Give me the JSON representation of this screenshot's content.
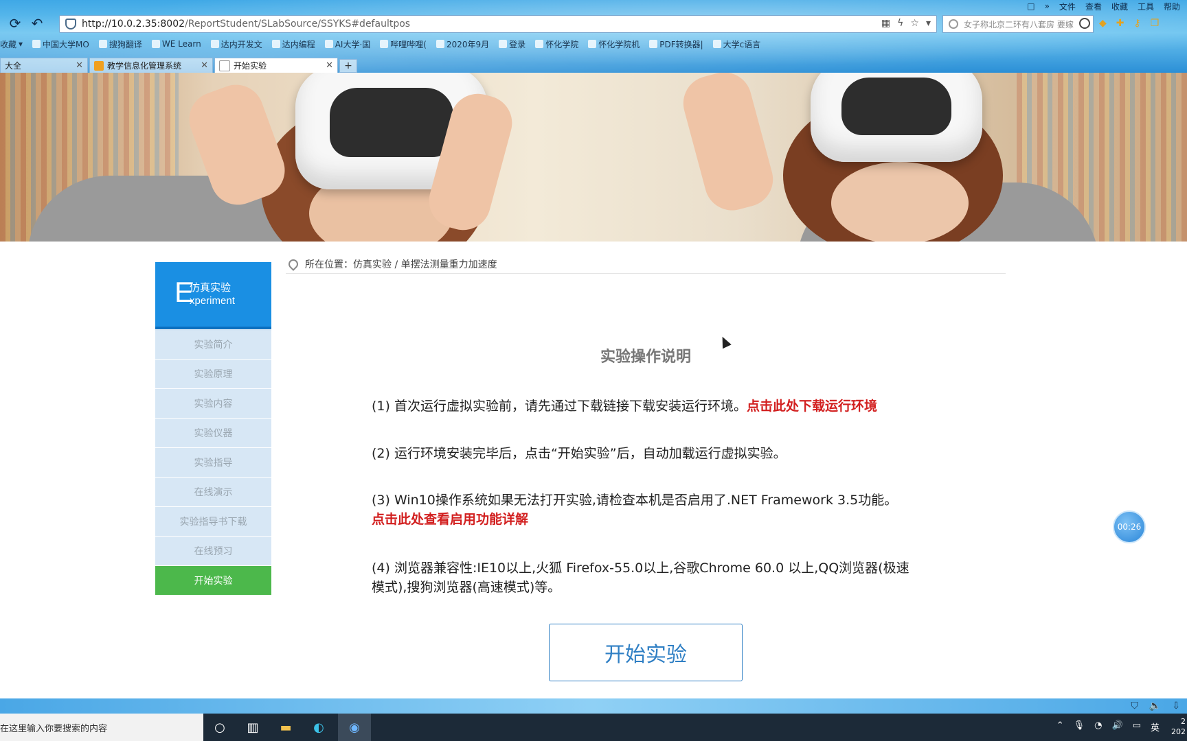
{
  "browser": {
    "menu": [
      "文件",
      "查看",
      "收藏",
      "工具",
      "帮助"
    ],
    "url_host": "http://10.0.2.35:8002",
    "url_path": "/ReportStudent/SLabSource/SSYKS#defaultpos",
    "search_text": "女子称北京二环有八套房 要嫁",
    "bookmarks": [
      "收藏",
      "中国大学MO",
      "搜狗翻译",
      "WE Learn",
      "达内开发文",
      "达内编程",
      "AI大学·国",
      "哔哩哔哩(",
      "2020年9月",
      "登录",
      "怀化学院",
      "怀化学院机",
      "PDF转换器|",
      "大学c语言"
    ],
    "tabs": [
      {
        "label": "大全",
        "active": false
      },
      {
        "label": "教学信息化管理系统",
        "active": false
      },
      {
        "label": "开始实验",
        "active": true
      }
    ],
    "new_tab": "+"
  },
  "sidebar": {
    "logo_letter": "E",
    "logo_cn": "仿真实验",
    "logo_en": "xperiment",
    "items": [
      {
        "label": "实验简介"
      },
      {
        "label": "实验原理"
      },
      {
        "label": "实验内容"
      },
      {
        "label": "实验仪器"
      },
      {
        "label": "实验指导"
      },
      {
        "label": "在线演示"
      },
      {
        "label": "实验指导书下载"
      },
      {
        "label": "在线预习"
      },
      {
        "label": "开始实验"
      }
    ]
  },
  "breadcrumb": {
    "prefix": "所在位置：",
    "path": "仿真实验 / 单摆法测量重力加速度"
  },
  "main": {
    "title": "实验操作说明",
    "p1_text": "(1) 首次运行虚拟实验前，请先通过下载链接下载安装运行环境。",
    "p1_link": "点击此处下载运行环境",
    "p2_text": "(2) 运行环境安装完毕后，点击“开始实验”后，自动加载运行虚拟实验。",
    "p3_text": "(3) Win10操作系统如果无法打开实验,请检查本机是否启用了.NET Framework 3.5功能。",
    "p3_link": "点击此处查看启用功能详解",
    "p4_text": "(4) 浏览器兼容性:IE10以上,火狐 Firefox-55.0以上,谷歌Chrome 60.0 以上,QQ浏览器(极速模式),搜狗浏览器(高速模式)等。",
    "start_button": "开始实验",
    "timer": "00:26"
  },
  "taskbar": {
    "search_placeholder": "在这里输入你要搜索的内容",
    "ime": "英",
    "clock_line1": "2",
    "clock_line2": "202"
  },
  "colors": {
    "sidebar_header": "#1a8fe3",
    "sidebar_item": "#d7e7f5",
    "active_item": "#4cb84b",
    "red_link": "#d21f1f",
    "button_blue": "#2f7fc4"
  }
}
